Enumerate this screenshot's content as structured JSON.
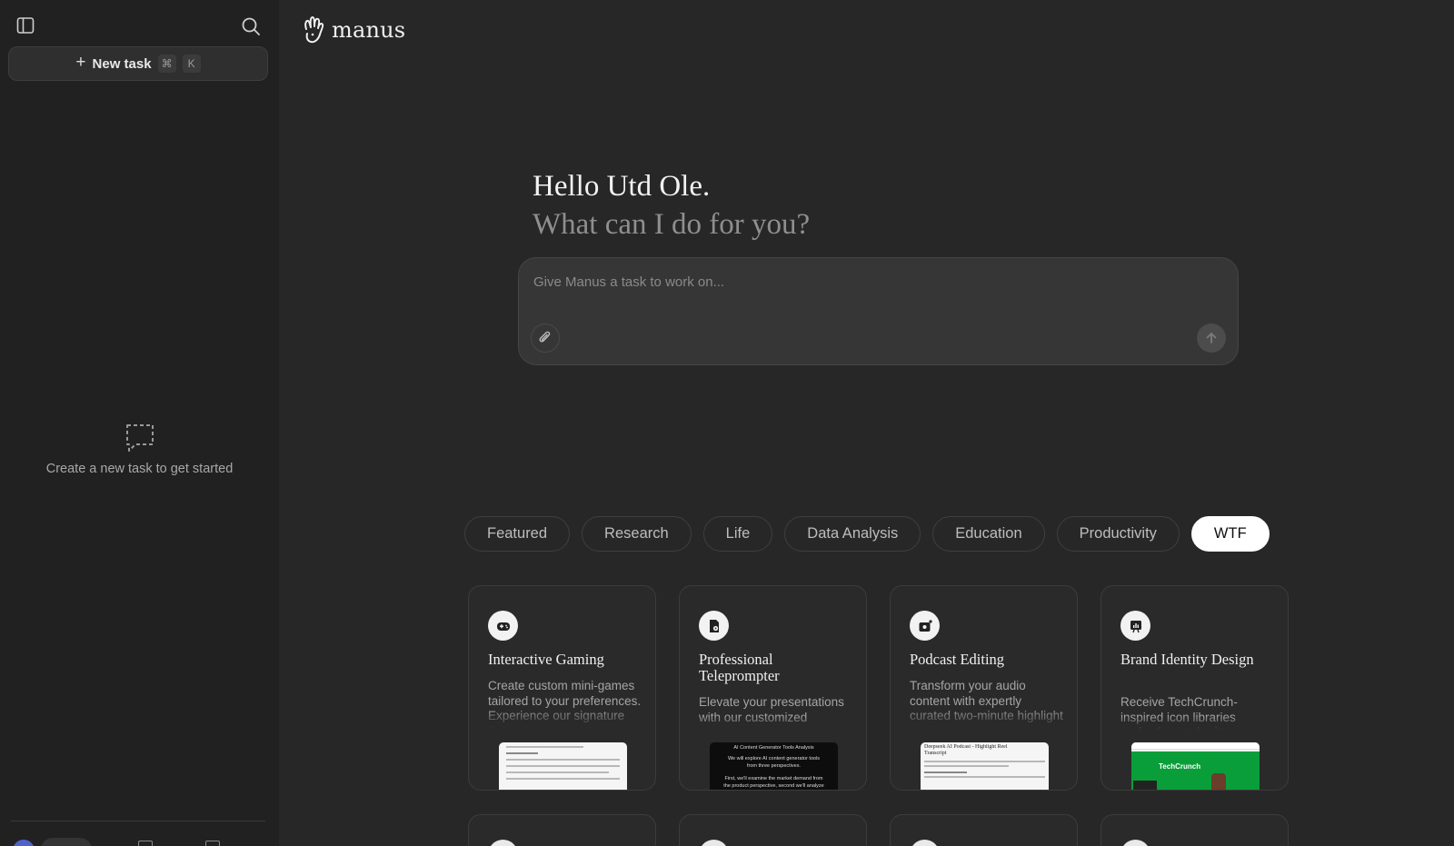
{
  "sidebar": {
    "new_task_label": "New task",
    "shortcut_keys": [
      "⌘",
      "K"
    ],
    "empty_text": "Create a new task to get started",
    "toggle_icon": "sidebar-toggle-icon",
    "search_icon": "search-icon"
  },
  "logo": {
    "text": "manus"
  },
  "greeting": {
    "line1": "Hello Utd Ole.",
    "line2": "What can I do for you?"
  },
  "composer": {
    "placeholder": "Give Manus a task to work on...",
    "attach_icon": "paperclip-icon",
    "send_icon": "arrow-up-icon"
  },
  "tabs": [
    {
      "label": "Featured",
      "active": false
    },
    {
      "label": "Research",
      "active": false
    },
    {
      "label": "Life",
      "active": false
    },
    {
      "label": "Data Analysis",
      "active": false
    },
    {
      "label": "Education",
      "active": false
    },
    {
      "label": "Productivity",
      "active": false
    },
    {
      "label": "WTF",
      "active": true
    }
  ],
  "cards": [
    {
      "title": "Interactive Gaming",
      "description": "Create custom mini-games tailored to your preferences. Experience our signature Zelensky",
      "icon": "gamepad-icon",
      "thumb_style": "document"
    },
    {
      "title": "Professional Teleprompter",
      "description": "Elevate your presentations with our customized",
      "icon": "document-play-icon",
      "thumb_style": "dark",
      "thumb_text": [
        "AI Content Generator Tools Analysis",
        "We will explore AI content generator tools",
        "from three perspectives.",
        "First, we'll examine the market demand from",
        "the product perspective, second we'll analyze"
      ]
    },
    {
      "title": "Podcast Editing",
      "description": "Transform your audio content with expertly curated two-minute highlight reels",
      "icon": "podcast-icon",
      "thumb_style": "document",
      "thumb_text": [
        "Deepseek AI Podcast - Highlight Reel",
        "Transcript"
      ]
    },
    {
      "title": "Brand Identity Design",
      "description": "Receive TechCrunch-inspired icon libraries perfectly matched to",
      "icon": "chart-icon",
      "thumb_style": "green",
      "thumb_text": [
        "TechCrunch"
      ]
    }
  ],
  "colors": {
    "background": "#272727",
    "sidebar": "#212121",
    "active_tab_bg": "#ffffff",
    "brand_green": "#0a9e3a"
  }
}
